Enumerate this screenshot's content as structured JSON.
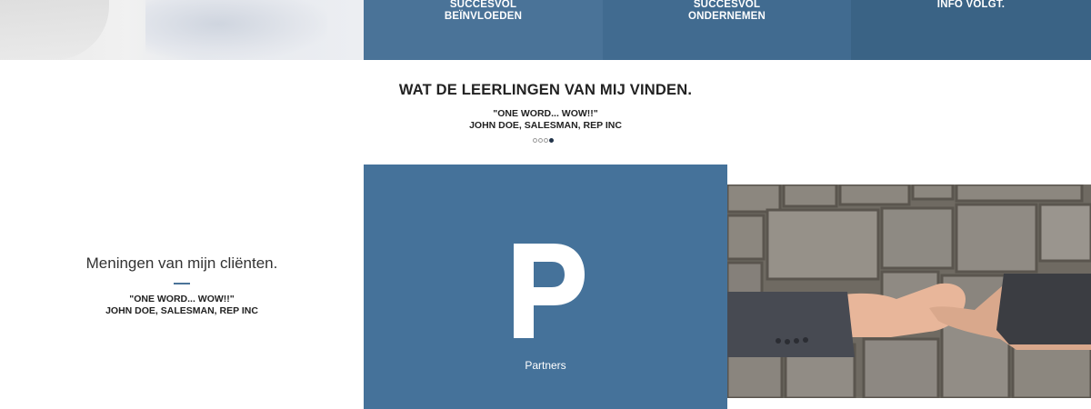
{
  "top_tiles": [
    {
      "label": "SUCCESVOL\nBEÏNVLOEDEN",
      "line1": "SUCCESVOL",
      "line2": "BEÏNVLOEDEN"
    },
    {
      "label": "SUCCESVOL\nONDERNEMEN",
      "line1": "SUCCESVOL",
      "line2": "ONDERNEMEN"
    },
    {
      "label": "INFO VOLGT.",
      "line1": "INFO VOLGT.",
      "line2": ""
    }
  ],
  "testimonials": {
    "title": "WAT DE LEERLINGEN VAN MIJ VINDEN.",
    "quote": "\"ONE WORD... WOW!!\"",
    "author": "JOHN DOE, SALESMAN, REP INC",
    "slide_count": 4,
    "active_slide": 4
  },
  "clients": {
    "heading": "Meningen van mijn cliënten.",
    "quote": "\"ONE WORD... WOW!!\"",
    "author": "JOHN DOE, SALESMAN, REP INC"
  },
  "partners": {
    "letter": "P",
    "label": "Partners",
    "tile_color": "#45729a"
  },
  "colors": {
    "accent": "#4a7398",
    "tile1": "#4a7398",
    "tile2": "#416b90",
    "tile3": "#3a6385",
    "text_dark": "#222222"
  },
  "images": {
    "top_left": "blurred-office-photo",
    "right": "handshake-stone-wall-photo"
  }
}
